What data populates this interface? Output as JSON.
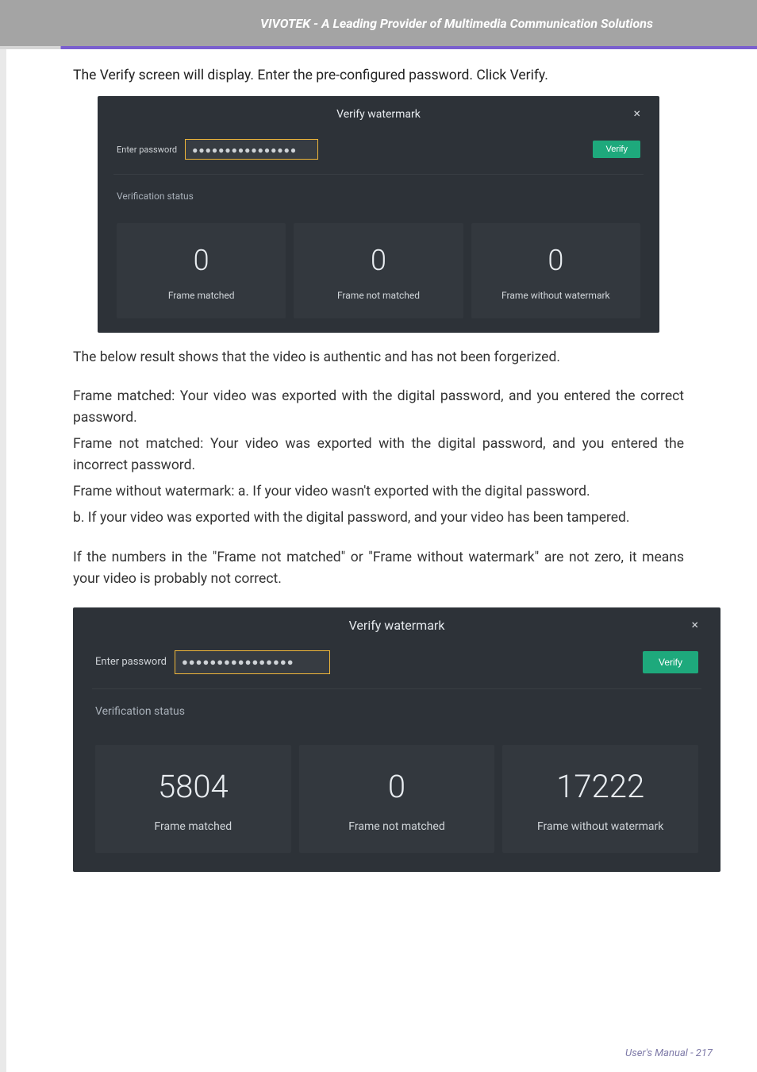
{
  "header": {
    "tagline": "VIVOTEK - A Leading Provider of Multimedia Communication Solutions"
  },
  "intro1": "The Verify screen will display. Enter the pre-configured password. Click Verify.",
  "dialog1": {
    "title": "Verify watermark",
    "close": "×",
    "pw_label": "Enter password",
    "pw_value": "●●●●●●●●●●●●●●●●",
    "verify_label": "Verify",
    "status_label": "Verification status",
    "cards": [
      {
        "num": "0",
        "label": "Frame matched"
      },
      {
        "num": "0",
        "label": "Frame not matched"
      },
      {
        "num": "0",
        "label": "Frame without watermark"
      }
    ]
  },
  "body": {
    "p1": "The below result shows that the video is authentic and has not been forgerized.",
    "p2": "Frame matched: Your video was exported with the digital password, and you entered the correct password.",
    "p3": "Frame not matched: Your video was exported with the digital password, and you entered the incorrect password.",
    "p4": "Frame without watermark: a. If your video wasn't exported with the digital password.",
    "p5": "b. If your video was exported with the digital password, and your video has been tampered.",
    "p6": "If the numbers in the \"Frame not matched\" or \"Frame without watermark\" are not zero, it means your video is probably not correct."
  },
  "dialog2": {
    "title": "Verify watermark",
    "close": "×",
    "pw_label": "Enter password",
    "pw_value": "●●●●●●●●●●●●●●●●",
    "verify_label": "Verify",
    "status_label": "Verification status",
    "cards": [
      {
        "num": "5804",
        "label": "Frame matched"
      },
      {
        "num": "0",
        "label": "Frame not matched"
      },
      {
        "num": "17222",
        "label": "Frame without watermark"
      }
    ]
  },
  "footer": "User's Manual - 217"
}
